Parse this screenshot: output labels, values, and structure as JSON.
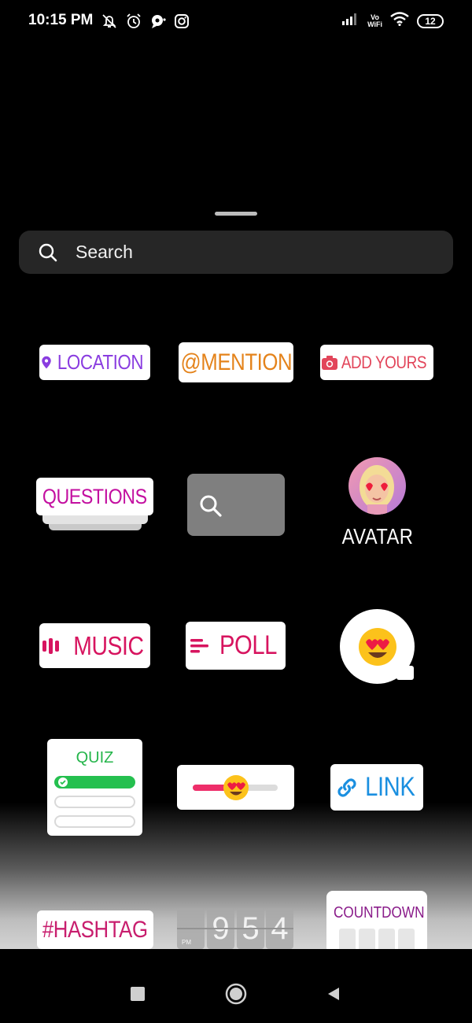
{
  "status_bar": {
    "time": "10:15 PM",
    "battery": "12",
    "vowifi_top": "Vo",
    "vowifi_bottom": "WiFi",
    "icons": [
      "mute-bell-icon",
      "alarm-icon",
      "chat-bubble-icon",
      "instagram-icon",
      "signal-icon",
      "wifi-icon",
      "battery-icon"
    ]
  },
  "search": {
    "placeholder": "Search"
  },
  "stickers": {
    "location": "LOCATION",
    "mention": "@MENTION",
    "add_yours": "ADD YOURS",
    "questions": "QUESTIONS",
    "avatar": "AVATAR",
    "music": "MUSIC",
    "poll": "POLL",
    "quiz": "QUIZ",
    "link": "LINK",
    "hashtag": "#HASHTAG",
    "time_digits": [
      "9",
      "5",
      "4"
    ],
    "time_ampm": "PM",
    "countdown": "COUNTDOWN"
  },
  "colors": {
    "location": "#8a3de0",
    "mention": "#e4831b",
    "add_yours": "#e2455a",
    "questions": "#c30fa0",
    "music": "#d7145f",
    "quiz": "#25b54b",
    "link": "#1a8fe0",
    "hashtag": "#c81e6e",
    "countdown": "#8a1c8a"
  },
  "navigation": {
    "icons": [
      "recents-square-icon",
      "home-circle-icon",
      "back-triangle-icon"
    ]
  }
}
